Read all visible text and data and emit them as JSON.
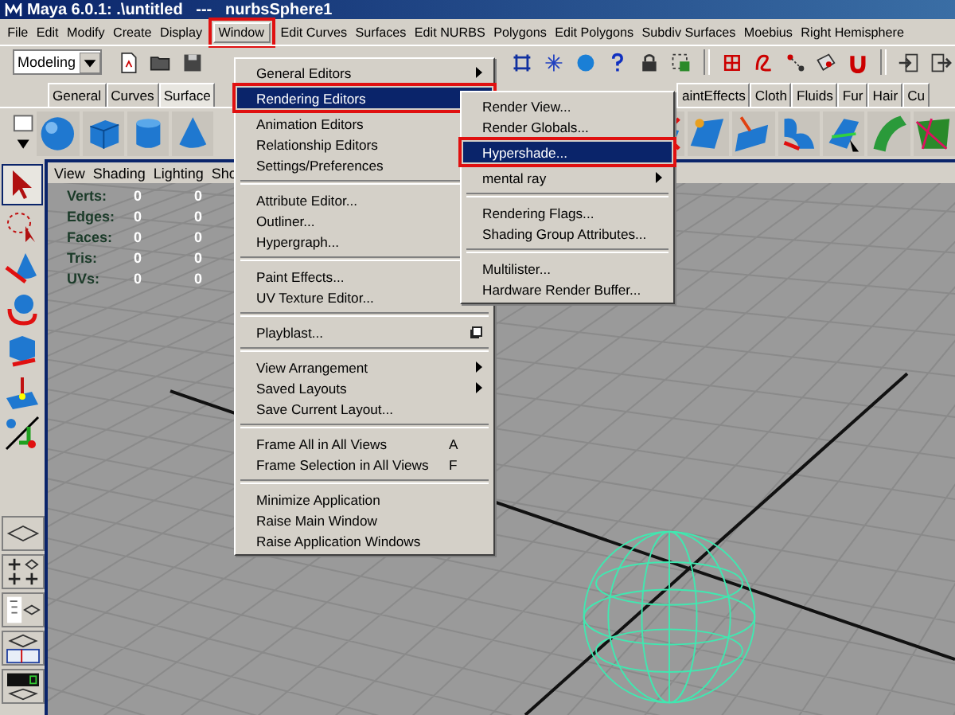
{
  "window": {
    "title": "Maya 6.0.1: .\\untitled   ---   nurbsSphere1"
  },
  "menu_bar": [
    {
      "label": "File",
      "selected": false
    },
    {
      "label": "Edit",
      "selected": false
    },
    {
      "label": "Modify",
      "selected": false
    },
    {
      "label": "Create",
      "selected": false
    },
    {
      "label": "Display",
      "selected": false
    },
    {
      "label": "Window",
      "selected": true
    },
    {
      "label": "Edit Curves",
      "selected": false
    },
    {
      "label": "Surfaces",
      "selected": false
    },
    {
      "label": "Edit NURBS",
      "selected": false
    },
    {
      "label": "Polygons",
      "selected": false
    },
    {
      "label": "Edit Polygons",
      "selected": false
    },
    {
      "label": "Subdiv Surfaces",
      "selected": false
    },
    {
      "label": "Moebius",
      "selected": false
    },
    {
      "label": "Right Hemisphere",
      "selected": false
    }
  ],
  "toolbar": {
    "mode_dropdown": "Modeling"
  },
  "shelf_tabs": [
    {
      "label": "General",
      "selected": false
    },
    {
      "label": "Curves",
      "selected": false
    },
    {
      "label": "Surface",
      "selected": true
    },
    {
      "label": "aintEffects",
      "selected": false
    },
    {
      "label": "Cloth",
      "selected": false
    },
    {
      "label": "Fluids",
      "selected": false
    },
    {
      "label": "Fur",
      "selected": false
    },
    {
      "label": "Hair",
      "selected": false
    },
    {
      "label": "Cu",
      "selected": false
    }
  ],
  "viewport": {
    "menu": [
      "View",
      "Shading",
      "Lighting",
      "Sho"
    ],
    "hud": [
      {
        "label": "Verts:",
        "value_1": "0",
        "value_2": "0"
      },
      {
        "label": "Edges:",
        "value_1": "0",
        "value_2": "0"
      },
      {
        "label": "Faces:",
        "value_1": "0",
        "value_2": "0"
      },
      {
        "label": "Tris:",
        "value_1": "0",
        "value_2": "0"
      },
      {
        "label": "UVs:",
        "value_1": "0",
        "value_2": "0"
      }
    ]
  },
  "window_menu": {
    "items": [
      {
        "kind": "submenu",
        "label": "General Editors",
        "selected": false
      },
      {
        "kind": "submenu",
        "label": "Rendering Editors",
        "selected": true
      },
      {
        "kind": "submenu",
        "label": "Animation Editors",
        "selected": false
      },
      {
        "kind": "submenu",
        "label": "Relationship Editors",
        "selected": false
      },
      {
        "kind": "submenu",
        "label": "Settings/Preferences",
        "selected": false
      },
      {
        "kind": "separator"
      },
      {
        "kind": "item",
        "label": "Attribute Editor...",
        "selected": false
      },
      {
        "kind": "item",
        "label": "Outliner...",
        "selected": false
      },
      {
        "kind": "item",
        "label": "Hypergraph...",
        "selected": false
      },
      {
        "kind": "separator"
      },
      {
        "kind": "item",
        "label": "Paint Effects...",
        "selected": false
      },
      {
        "kind": "item",
        "label": "UV Texture Editor...",
        "selected": false
      },
      {
        "kind": "separator"
      },
      {
        "kind": "option",
        "label": "Playblast...",
        "selected": false
      },
      {
        "kind": "separator"
      },
      {
        "kind": "submenu",
        "label": "View Arrangement",
        "selected": false
      },
      {
        "kind": "submenu",
        "label": "Saved Layouts",
        "selected": false
      },
      {
        "kind": "item",
        "label": "Save Current Layout...",
        "selected": false
      },
      {
        "kind": "separator"
      },
      {
        "kind": "shortcut",
        "label": "Frame All in All Views",
        "shortcut": "A",
        "selected": false
      },
      {
        "kind": "shortcut",
        "label": "Frame Selection in All Views",
        "shortcut": "F",
        "selected": false
      },
      {
        "kind": "separator"
      },
      {
        "kind": "item",
        "label": "Minimize Application",
        "selected": false
      },
      {
        "kind": "item",
        "label": "Raise Main Window",
        "selected": false
      },
      {
        "kind": "item",
        "label": "Raise Application Windows",
        "selected": false
      }
    ]
  },
  "rendering_submenu": {
    "items": [
      {
        "kind": "item",
        "label": "Render View...",
        "selected": false
      },
      {
        "kind": "item",
        "label": "Render Globals...",
        "selected": false
      },
      {
        "kind": "item",
        "label": "Hypershade...",
        "selected": true
      },
      {
        "kind": "submenu",
        "label": "mental ray",
        "selected": false
      },
      {
        "kind": "separator"
      },
      {
        "kind": "item",
        "label": "Rendering Flags...",
        "selected": false
      },
      {
        "kind": "item",
        "label": "Shading Group Attributes...",
        "selected": false
      },
      {
        "kind": "separator"
      },
      {
        "kind": "item",
        "label": "Multilister...",
        "selected": false
      },
      {
        "kind": "item",
        "label": "Hardware Render Buffer...",
        "selected": false
      }
    ]
  }
}
